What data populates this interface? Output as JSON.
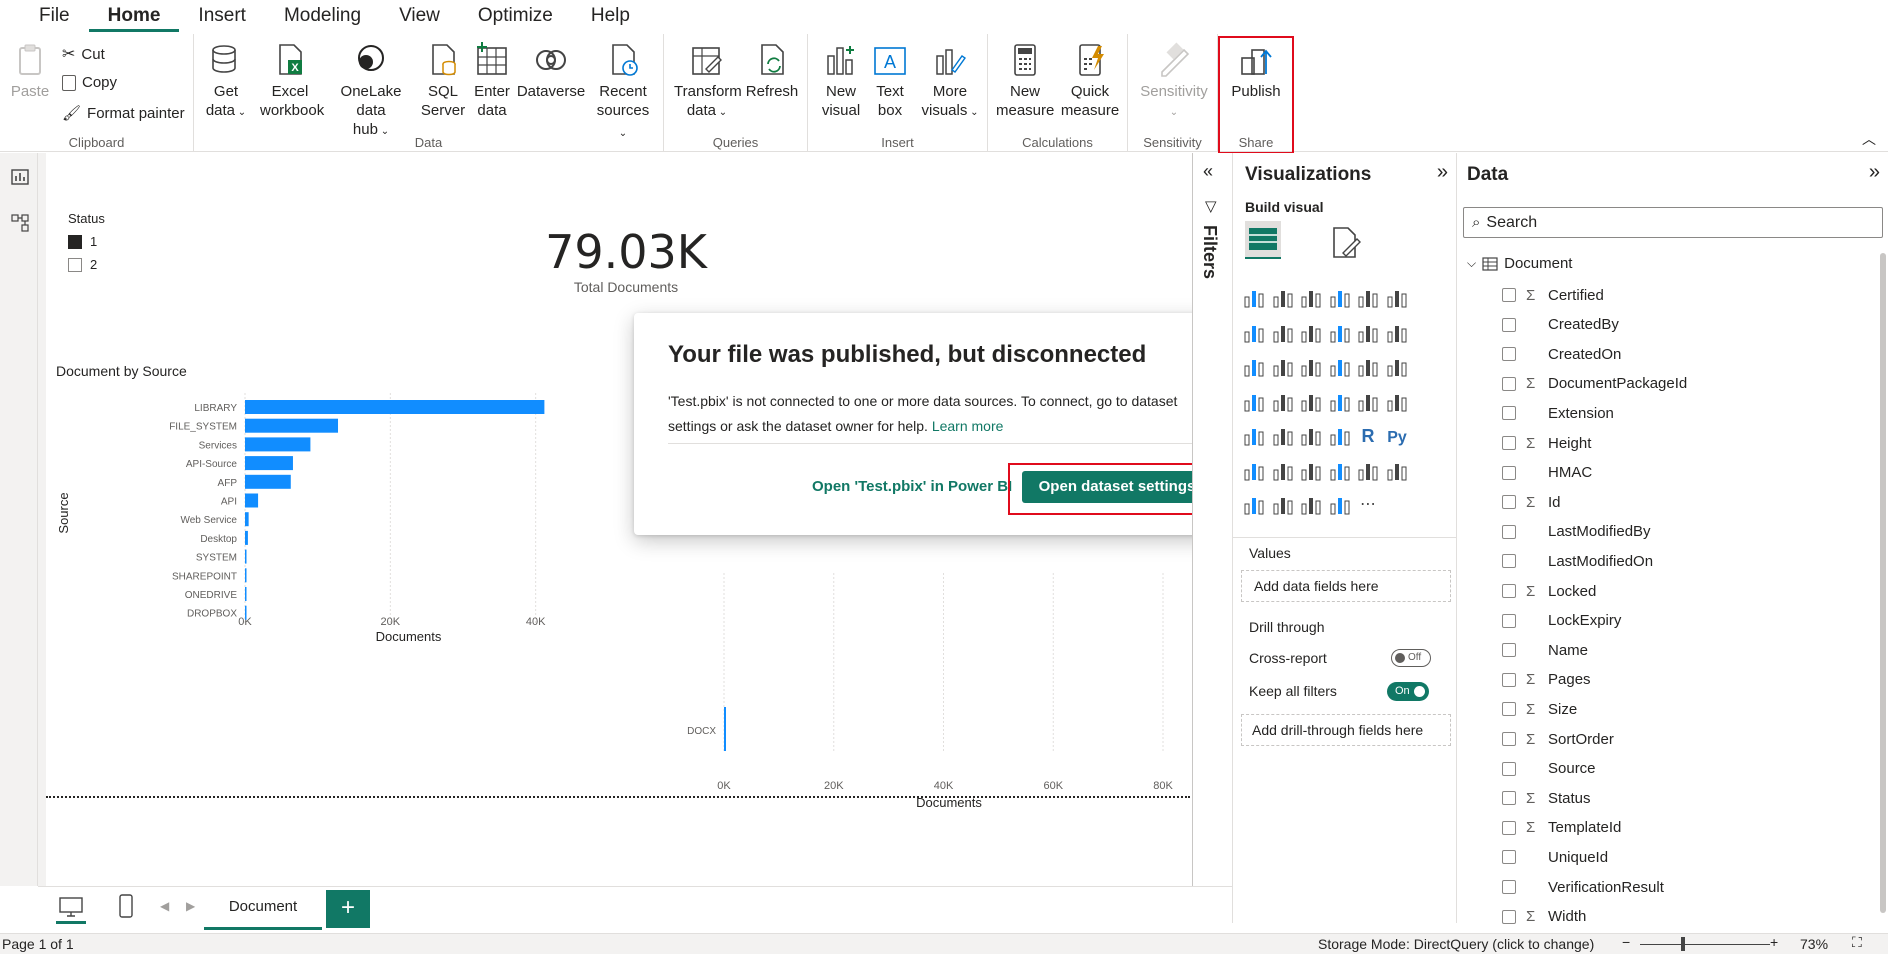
{
  "menu": [
    "File",
    "Home",
    "Insert",
    "Modeling",
    "View",
    "Optimize",
    "Help"
  ],
  "ribbon": {
    "clipboard": {
      "label": "Clipboard",
      "paste": "Paste",
      "cut": "Cut",
      "copy": "Copy",
      "format_painter": "Format painter"
    },
    "data": {
      "label": "Data",
      "get_data": [
        "Get",
        "data"
      ],
      "excel": [
        "Excel",
        "workbook"
      ],
      "onelake": [
        "OneLake data",
        "hub"
      ],
      "sql": [
        "SQL",
        "Server"
      ],
      "enter": [
        "Enter",
        "data"
      ],
      "dataverse": "Dataverse",
      "recent": [
        "Recent",
        "sources"
      ]
    },
    "queries": {
      "label": "Queries",
      "transform": [
        "Transform",
        "data"
      ],
      "refresh": "Refresh"
    },
    "insert": {
      "label": "Insert",
      "new_visual": [
        "New",
        "visual"
      ],
      "text_box": [
        "Text",
        "box"
      ],
      "more_visuals": [
        "More",
        "visuals"
      ]
    },
    "calculations": {
      "label": "Calculations",
      "new_measure": [
        "New",
        "measure"
      ],
      "quick_measure": [
        "Quick",
        "measure"
      ]
    },
    "sensitivity": {
      "label": "Sensitivity",
      "sensitivity": "Sensitivity"
    },
    "share": {
      "label": "Share",
      "publish": "Publish"
    }
  },
  "report": {
    "slicer": {
      "title": "Status",
      "items": [
        "1",
        "2"
      ]
    },
    "card": {
      "value": "79.03K",
      "label": "Total Documents"
    },
    "chart1_title": "Document by Source",
    "chart2_category": "DOCX"
  },
  "chart_data": [
    {
      "type": "bar",
      "title": "Document by Source",
      "xlabel": "Documents",
      "ylabel": "Source",
      "categories": [
        "LIBRARY",
        "FILE_SYSTEM",
        "Services",
        "API-Source",
        "AFP",
        "API",
        "Web Service",
        "Desktop",
        "SYSTEM",
        "SHAREPOINT",
        "ONEDRIVE",
        "DROPBOX"
      ],
      "values": [
        41200,
        12800,
        9000,
        6600,
        6300,
        1800,
        500,
        400,
        200,
        100,
        80,
        50
      ],
      "xlim": [
        0,
        45000
      ],
      "xticks": [
        "0K",
        "20K",
        "40K"
      ],
      "color": "#118dff"
    },
    {
      "type": "bar",
      "xlabel": "Documents",
      "categories": [
        "DOCX"
      ],
      "values": [
        200
      ],
      "xlim": [
        0,
        82000
      ],
      "xticks": [
        "0K",
        "20K",
        "40K",
        "60K",
        "80K"
      ],
      "color": "#118dff"
    }
  ],
  "dialog": {
    "title": "Your file was published, but disconnected",
    "body": "'Test.pbix' is not connected to one or more data sources. To connect, go to dataset settings or ask the dataset owner for help.",
    "learn_more": "Learn more",
    "secondary": "Open 'Test.pbix' in Power BI",
    "primary": "Open dataset settings"
  },
  "filters_label": "Filters",
  "viz": {
    "title": "Visualizations",
    "build": "Build visual",
    "values_label": "Values",
    "values_placeholder": "Add data fields here",
    "drill_label": "Drill through",
    "cross_report": "Cross-report",
    "cross_state": "Off",
    "keep_filters": "Keep all filters",
    "keep_state": "On",
    "drill_placeholder": "Add drill-through fields here"
  },
  "data_pane": {
    "title": "Data",
    "search_placeholder": "Search",
    "table": "Document",
    "fields": [
      {
        "name": "Certified",
        "sigma": true
      },
      {
        "name": "CreatedBy",
        "sigma": false
      },
      {
        "name": "CreatedOn",
        "sigma": false
      },
      {
        "name": "DocumentPackageId",
        "sigma": true
      },
      {
        "name": "Extension",
        "sigma": false
      },
      {
        "name": "Height",
        "sigma": true
      },
      {
        "name": "HMAC",
        "sigma": false
      },
      {
        "name": "Id",
        "sigma": true
      },
      {
        "name": "LastModifiedBy",
        "sigma": false
      },
      {
        "name": "LastModifiedOn",
        "sigma": false
      },
      {
        "name": "Locked",
        "sigma": true
      },
      {
        "name": "LockExpiry",
        "sigma": false
      },
      {
        "name": "Name",
        "sigma": false
      },
      {
        "name": "Pages",
        "sigma": true
      },
      {
        "name": "Size",
        "sigma": true
      },
      {
        "name": "SortOrder",
        "sigma": true
      },
      {
        "name": "Source",
        "sigma": false
      },
      {
        "name": "Status",
        "sigma": true
      },
      {
        "name": "TemplateId",
        "sigma": true
      },
      {
        "name": "UniqueId",
        "sigma": false
      },
      {
        "name": "VerificationResult",
        "sigma": false
      },
      {
        "name": "Width",
        "sigma": true
      }
    ]
  },
  "page_tab": "Document",
  "status": {
    "page": "Page 1 of 1",
    "storage": "Storage Mode: DirectQuery (click to change)",
    "zoom": "73%"
  },
  "colors": {
    "accent": "#117865",
    "bar": "#118dff",
    "highlight": "#e00b1c"
  }
}
